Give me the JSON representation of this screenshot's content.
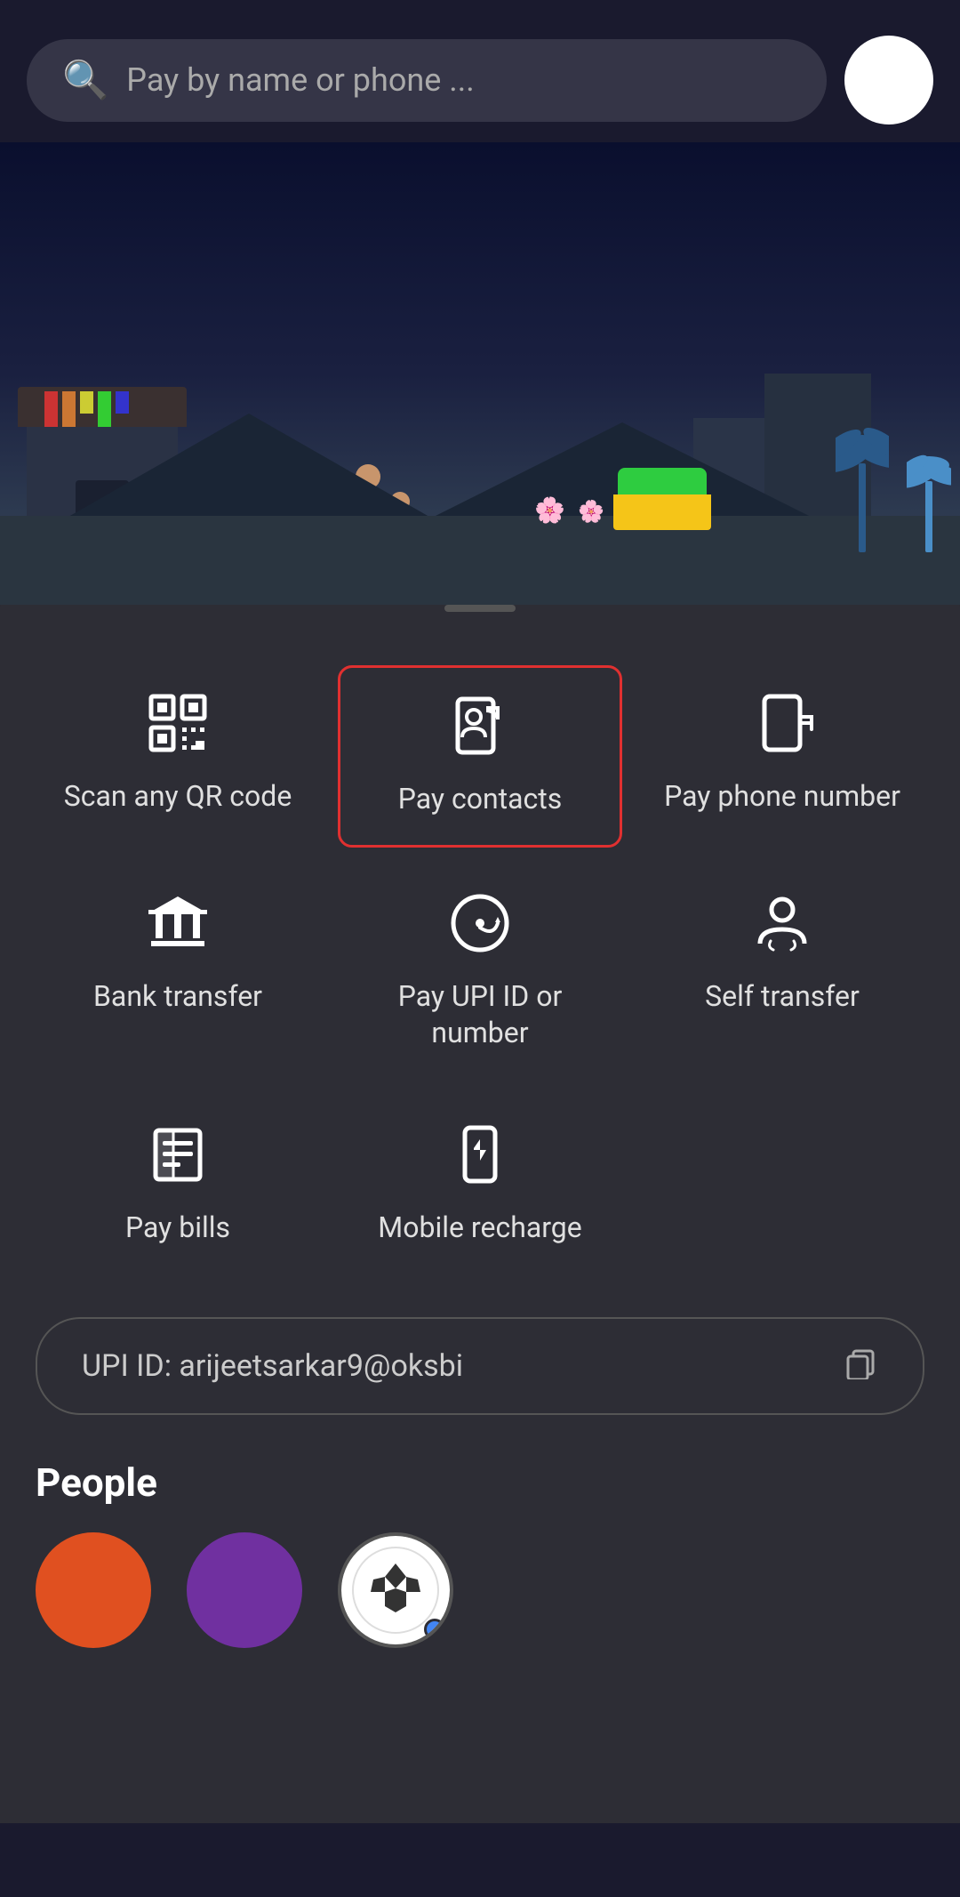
{
  "header": {
    "search_placeholder": "Pay by name or phone ...",
    "avatar_label": "User Avatar"
  },
  "actions": {
    "items": [
      {
        "id": "scan-qr",
        "label": "Scan any QR code",
        "icon": "qr",
        "selected": false
      },
      {
        "id": "pay-contacts",
        "label": "Pay contacts",
        "icon": "contacts",
        "selected": true
      },
      {
        "id": "pay-phone",
        "label": "Pay phone number",
        "icon": "phone",
        "selected": false
      },
      {
        "id": "bank-transfer",
        "label": "Bank transfer",
        "icon": "bank",
        "selected": false
      },
      {
        "id": "pay-upi",
        "label": "Pay UPI ID or number",
        "icon": "upi",
        "selected": false
      },
      {
        "id": "self-transfer",
        "label": "Self transfer",
        "icon": "self",
        "selected": false
      },
      {
        "id": "pay-bills",
        "label": "Pay bills",
        "icon": "bills",
        "selected": false
      },
      {
        "id": "mobile-recharge",
        "label": "Mobile recharge",
        "icon": "mobile",
        "selected": false
      }
    ]
  },
  "upi": {
    "label": "UPI ID: arijeetsarkar9@oksbi",
    "copy_label": "⧉"
  },
  "people_section": {
    "title": "People",
    "people": [
      {
        "id": "person-1",
        "color": "orange",
        "initial": ""
      },
      {
        "id": "person-2",
        "color": "purple",
        "initial": ""
      },
      {
        "id": "person-3",
        "color": "multi",
        "initial": ""
      }
    ]
  },
  "colors": {
    "selected_border": "#e03030",
    "background": "#2d2d35",
    "text_primary": "#ffffff",
    "text_secondary": "#aaaaaa"
  }
}
